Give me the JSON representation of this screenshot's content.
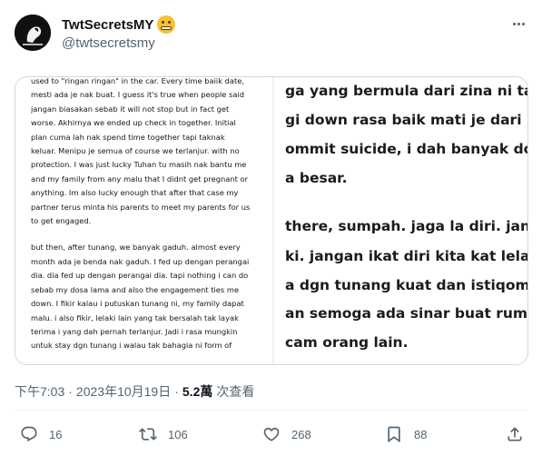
{
  "author": {
    "display_name": "TwtSecretsMY",
    "handle": "@twtsecretsmy",
    "emoji": "grimacing-face-emoji"
  },
  "media": {
    "left_paragraphs": [
      "used to \"ringan ringan\" in the car. Every time baiik date,\nmesti ada je nak buat. I guess it's true when people said\njangan biasakan sebab it will not stop but in fact get\nworse. Akhirnya we ended up check in together. Initial\nplan cuma lah nak spend time together tapi taknak\nkeluar. Menipu je semua of course we terlanjur. with no\nprotection. I was just lucky Tuhan tu masih nak bantu me\nand my family from any malu that I didnt get pregnant or\nanything. Im also lucky enough that after that case my\npartner terus minta his parents to meet my parents for us\nto get engaged.",
      "but then, after tunang, we banyak gaduh. almost every\nmonth ada je benda nak gaduh. I fed up dengan perangai\ndia. dia fed up dengan perangai dia. tapi nothing i can do\nsebab my dosa lama and also the engagement ties me\ndown. I fikir kalau i putuskan tunang ni, my family dapat\nmalu. i also fikir, lelaki lain yang tak bersalah tak layak\nterima i yang dah pernah terlanjur. Jadi i rasa mungkin\nuntuk stay dgn tunang i walau tak bahagia ni form of"
    ],
    "right_lines": [
      "ga yang bermula dari zina ni takkan",
      "gi down rasa baik mati je dari kahw",
      "ommit suicide, i dah banyak dosa n",
      "a besar.",
      "there, sumpah. jaga la diri. jangan l",
      "ki. jangan ikat diri kita kat lelaki sel",
      "a dgn tunang kuat dan istiqomah b",
      "an semoga ada sinar buat rumah ta",
      "cam orang lain."
    ]
  },
  "meta": {
    "time": "下午7:03",
    "separator": "·",
    "date": "2023年10月19日",
    "views_count": "5.2萬",
    "views_label": "次查看"
  },
  "actions": {
    "replies": "16",
    "retweets": "106",
    "likes": "268",
    "bookmarks": "88"
  },
  "colors": {
    "text_primary": "#0f1419",
    "text_secondary": "#536471",
    "border": "#cfd9de"
  }
}
